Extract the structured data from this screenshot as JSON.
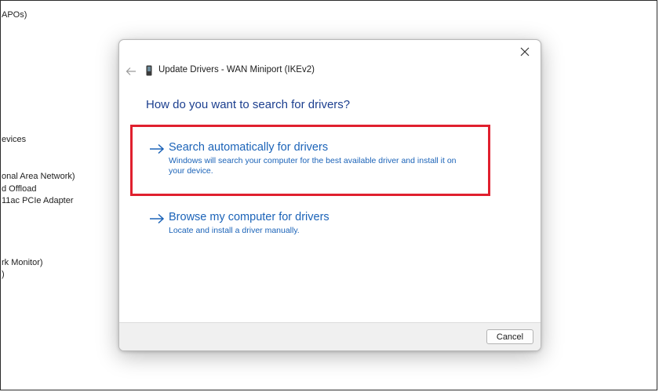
{
  "background_list": {
    "items": [
      {
        "text": "APOs)"
      },
      {
        "text": "evices"
      },
      {
        "text": "onal Area Network)"
      },
      {
        "text": "d Offload"
      },
      {
        "text": "11ac PCIe Adapter"
      },
      {
        "text": "rk Monitor)"
      },
      {
        "text": ")"
      }
    ]
  },
  "dialog": {
    "title": "Update Drivers - WAN Miniport (IKEv2)",
    "heading": "How do you want to search for drivers?",
    "close_icon": "close-icon",
    "back_icon": "back-arrow-icon",
    "device_icon": "device-icon",
    "options": [
      {
        "title": "Search automatically for drivers",
        "description": "Windows will search your computer for the best available driver and install it on your device.",
        "highlighted": true
      },
      {
        "title": "Browse my computer for drivers",
        "description": "Locate and install a driver manually.",
        "highlighted": false
      }
    ],
    "cancel_label": "Cancel"
  },
  "colors": {
    "link": "#1b63b8",
    "heading": "#1c3f8f",
    "highlight": "#e0202e",
    "footer": "#f0f0f0"
  }
}
